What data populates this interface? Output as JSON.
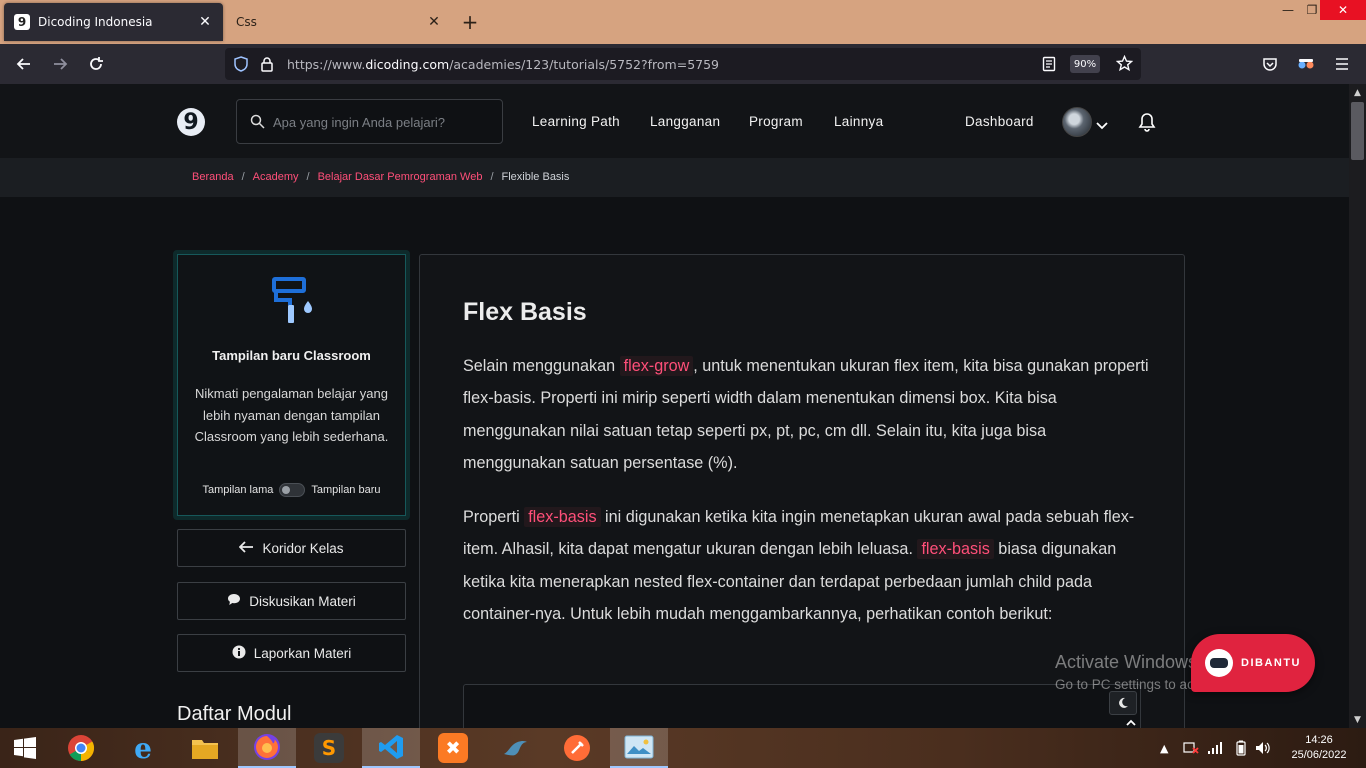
{
  "browser": {
    "tabs": [
      {
        "favicon": "9",
        "title": "Dicoding Indonesia",
        "active": true
      },
      {
        "title": "Css",
        "active": false
      }
    ],
    "url_prefix": "https://www.",
    "url_domain": "dicoding.com",
    "url_path": "/academies/123/tutorials/5752?from=5759",
    "zoom": "90%"
  },
  "site": {
    "logo": "9",
    "search_placeholder": "Apa yang ingin Anda pelajari?",
    "nav": [
      "Learning Path",
      "Langganan",
      "Program",
      "Lainnya"
    ],
    "dashboard": "Dashboard"
  },
  "breadcrumb": {
    "items": [
      "Beranda",
      "Academy",
      "Belajar Dasar Pemrograman Web"
    ],
    "separator": "/",
    "current": "Flexible Basis"
  },
  "sidebar": {
    "promo": {
      "title": "Tampilan baru Classroom",
      "description": "Nikmati pengalaman belajar yang lebih nyaman dengan tampilan Classroom yang lebih sederhana.",
      "toggle_left": "Tampilan lama",
      "toggle_right": "Tampilan baru"
    },
    "buttons": [
      "Koridor Kelas",
      "Diskusikan Materi",
      "Laporkan Materi"
    ],
    "module_heading": "Daftar Modul"
  },
  "content": {
    "title": "Flex Basis",
    "p1": {
      "a": "Selain menggunakan ",
      "code": "flex-grow",
      "b": ", untuk menentukan ukuran flex item, kita bisa gunakan properti flex-basis. Properti ini mirip seperti width dalam menentukan dimensi box. Kita bisa menggunakan nilai satuan tetap seperti px, pt, pc, cm dll. Selain itu, kita juga bisa menggunakan satuan persentase (%)."
    },
    "p2": {
      "a": "Properti ",
      "code1": "flex-basis",
      "b": " ini digunakan ketika kita ingin menetapkan ukuran awal pada sebuah flex-item. Alhasil, kita dapat mengatur ukuran dengan lebih leluasa. ",
      "code2": "flex-basis",
      "c": " biasa digunakan ketika kita menerapkan nested flex-container dan terdapat perbedaan jumlah child pada container-nya. Untuk lebih mudah menggambarkannya, perhatikan contoh berikut:"
    }
  },
  "overlay": {
    "watermark_title": "Activate Windows",
    "watermark_sub": "Go to PC settings to activate Windows.",
    "help_label": "DIBANTU"
  },
  "taskbar": {
    "time": "14:26",
    "date": "25/06/2022"
  },
  "colors": {
    "accent": "#ff4f79",
    "help_bg": "#e0233f",
    "promo_border": "#16585a"
  }
}
